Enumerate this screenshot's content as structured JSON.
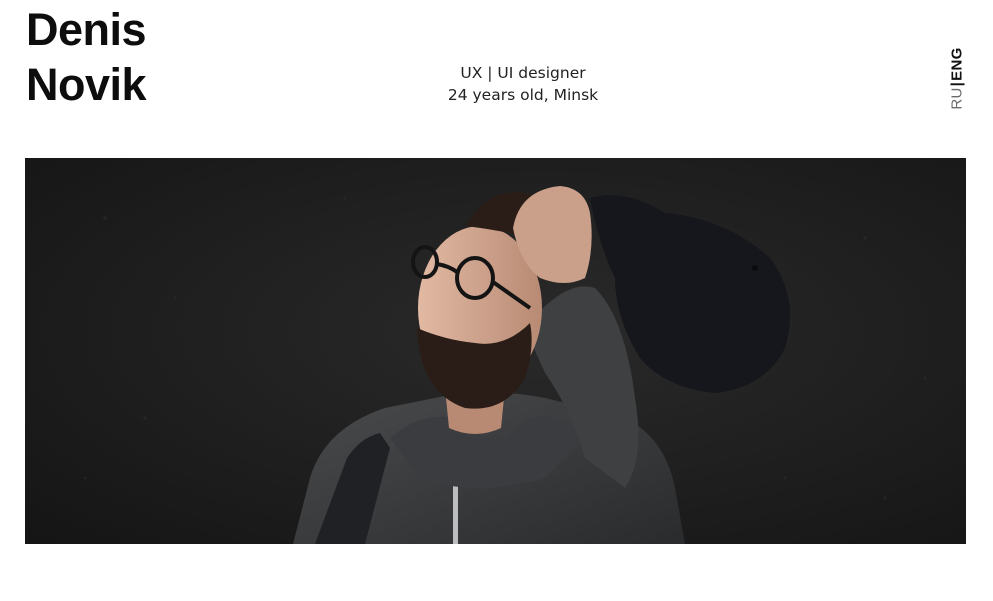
{
  "header": {
    "first_name": "Denis",
    "last_name": "Novik",
    "role": "UX | UI designer",
    "bio": "24 years old, Minsk"
  },
  "language": {
    "ru": "RU",
    "separator": "|",
    "eng": "ENG",
    "active": "ENG"
  },
  "hero": {
    "subject": "portrait-photo",
    "colors": {
      "wall": "#1c1c1c",
      "hoodie": "#3a3b3d",
      "cap": "#16171c",
      "skin": "#c9a08b",
      "beard": "#2a1d17"
    }
  }
}
